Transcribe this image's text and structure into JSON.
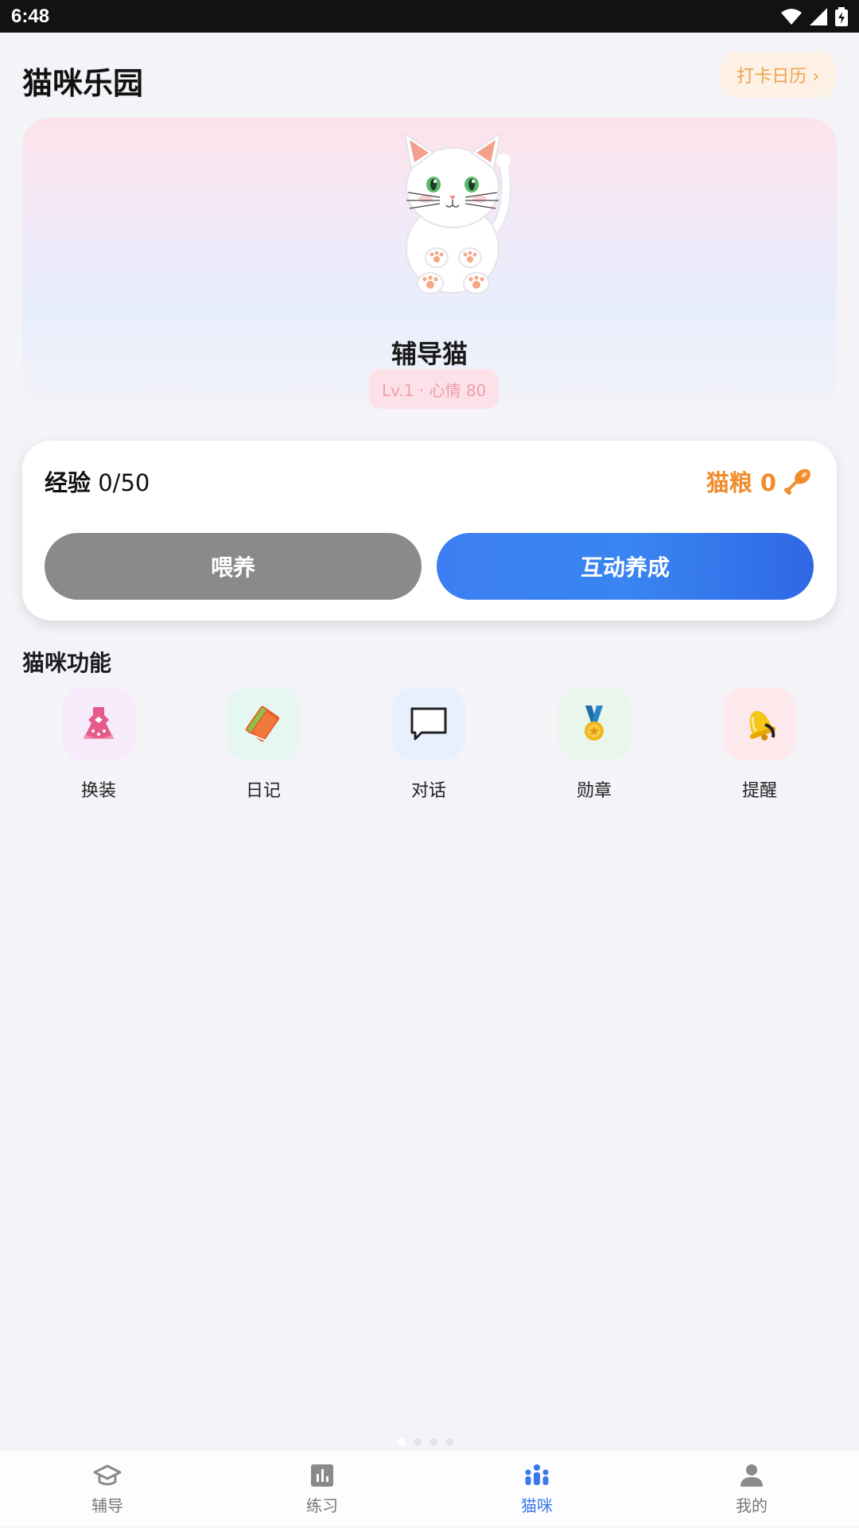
{
  "status_bar": {
    "time": "6:48"
  },
  "header": {
    "title": "猫咪乐园",
    "checkin_label": "打卡日历 ›"
  },
  "pet": {
    "name": "辅导猫",
    "level_mood": "Lv.1 · 心情 80"
  },
  "stats": {
    "exp_label": "经验",
    "exp_value": "0/50",
    "food_label": "猫粮 0"
  },
  "actions": {
    "feed_label": "喂养",
    "interact_label": "互动养成"
  },
  "features": {
    "title": "猫咪功能",
    "items": [
      {
        "label": "换装",
        "icon": "dress-icon",
        "bg": "#f6eafb"
      },
      {
        "label": "日记",
        "icon": "notebook-icon",
        "bg": "#e6f7f1"
      },
      {
        "label": "对话",
        "icon": "chat-bubble-icon",
        "bg": "#e8f0fd"
      },
      {
        "label": "勋章",
        "icon": "medal-icon",
        "bg": "#e8f6eb"
      },
      {
        "label": "提醒",
        "icon": "bell-icon",
        "bg": "#fde9ec"
      }
    ]
  },
  "bottom_nav": {
    "items": [
      {
        "label": "辅导",
        "icon": "graduation-cap-icon"
      },
      {
        "label": "练习",
        "icon": "bar-chart-icon"
      },
      {
        "label": "猫咪",
        "icon": "people-group-icon",
        "active": true
      },
      {
        "label": "我的",
        "icon": "person-icon"
      }
    ]
  },
  "colors": {
    "accent_blue": "#3a78e8",
    "food_orange": "#f08c2a",
    "feed_gray": "#8a8a8a"
  }
}
